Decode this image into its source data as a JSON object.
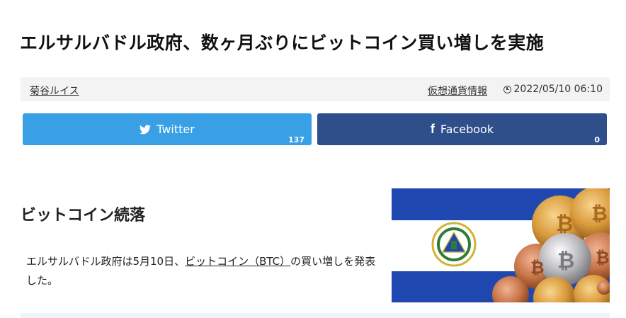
{
  "article": {
    "title": "エルサルバドル政府、数ヶ月ぶりにビットコイン買い増しを実施"
  },
  "meta": {
    "author": "菊谷ルイス",
    "category": "仮想通貨情報",
    "date": "2022/05/10 06:10",
    "clock_icon": "clock-icon"
  },
  "share": {
    "twitter_label": "Twitter",
    "twitter_count": "137",
    "twitter_color": "#3aa0e6",
    "facebook_label": "Facebook",
    "facebook_count": "0",
    "facebook_color": "#2f4f8b"
  },
  "section": {
    "heading": "ビットコイン続落",
    "text_before": "エルサルバドル政府は5月10日、",
    "link_text": "ビットコイン（BTC）",
    "text_after": "の買い増しを発表した。"
  },
  "hero": {
    "alt": "El Salvador flag with Bitcoin coins",
    "flag_blue": "#1f47b0",
    "coin_color": "#e09a3a"
  }
}
